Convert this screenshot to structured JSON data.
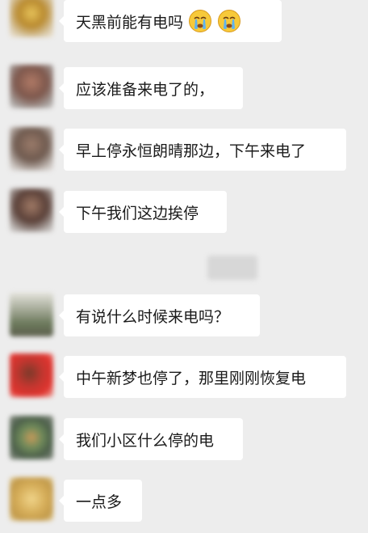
{
  "messages": [
    {
      "text": "天黑前能有电吗",
      "emojis": [
        "crying-face-icon",
        "crying-face-icon"
      ]
    },
    {
      "text": "应该准备来电了的，"
    },
    {
      "text": "早上停永恒朗晴那边，下午来电了"
    },
    {
      "text": "下午我们这边挨停"
    },
    {
      "text": "有说什么时候来电吗？"
    },
    {
      "text": "中午新梦也停了，那里刚刚恢复电"
    },
    {
      "text": "我们小区什么停的电"
    },
    {
      "text": "一点多"
    }
  ],
  "colors": {
    "background": "#ededed",
    "bubble": "#ffffff",
    "text": "#1a1a1a"
  }
}
